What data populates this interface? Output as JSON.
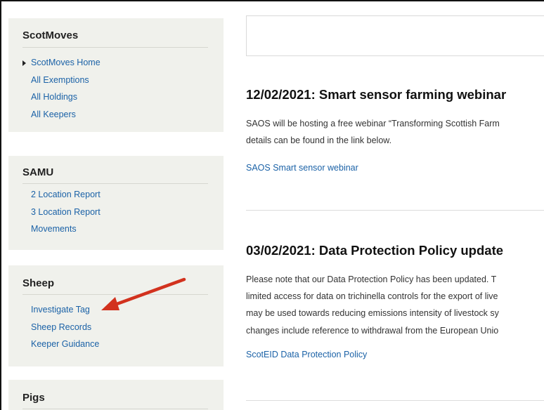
{
  "sidebar": {
    "scotmoves": {
      "title": "ScotMoves",
      "items": [
        {
          "label": "ScotMoves Home"
        },
        {
          "label": "All Exemptions"
        },
        {
          "label": "All Holdings"
        },
        {
          "label": "All Keepers"
        }
      ]
    },
    "samu": {
      "title": "SAMU",
      "items": [
        {
          "label": "2 Location Report"
        },
        {
          "label": "3 Location Report"
        },
        {
          "label": "Movements"
        }
      ]
    },
    "sheep": {
      "title": "Sheep",
      "items": [
        {
          "label": "Investigate Tag"
        },
        {
          "label": "Sheep Records"
        },
        {
          "label": "Keeper Guidance"
        }
      ]
    },
    "pigs": {
      "title": "Pigs"
    }
  },
  "articles": [
    {
      "title": "12/02/2021: Smart sensor farming webinar",
      "lines": [
        "SAOS will be hosting a free webinar “Transforming Scottish Farm",
        "details can be found in the link below."
      ],
      "link": "SAOS Smart sensor webinar"
    },
    {
      "title": "03/02/2021: Data Protection Policy update",
      "lines": [
        "Please note that our Data Protection Policy has been updated.  T",
        "limited access for data on trichinella controls for the export of live",
        "may be used towards reducing emissions intensity of livestock sy",
        "changes include reference to withdrawal from the European Unio"
      ],
      "link": "ScotEID Data Protection Policy"
    }
  ],
  "colors": {
    "link": "#1b62a7",
    "sidebar_bg": "#f0f1ec",
    "annotation_arrow": "#d2321e"
  }
}
